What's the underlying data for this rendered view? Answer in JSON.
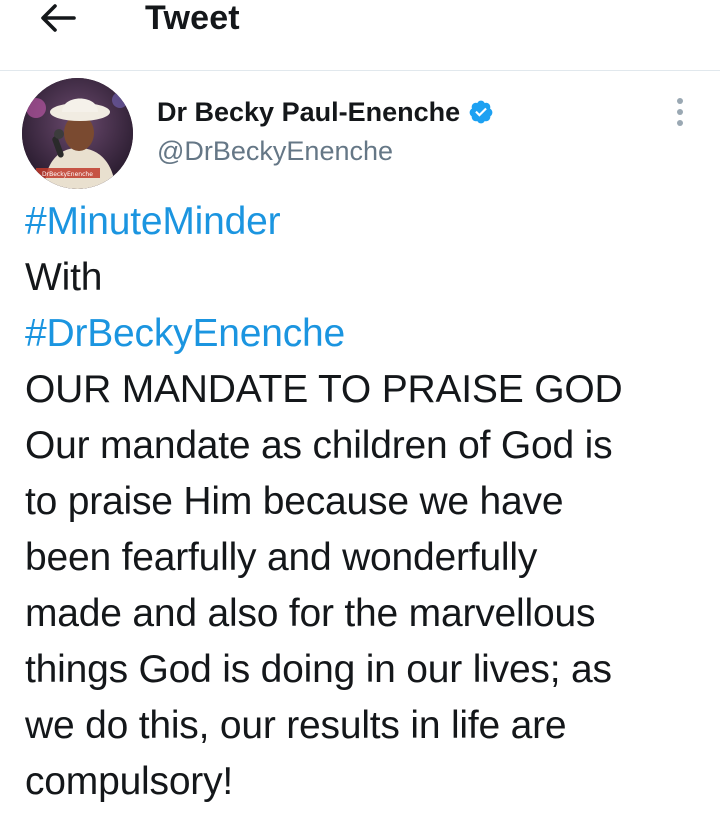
{
  "header": {
    "title": "Tweet",
    "back_icon": "arrow-left-icon"
  },
  "author": {
    "display_name": "Dr Becky Paul-Enenche",
    "handle": "@DrBeckyEnenche",
    "verified": true,
    "verified_icon": "verified-badge-icon",
    "avatar_watermark": "DrBeckyEnenche"
  },
  "more_icon": "more-vertical-icon",
  "tweet": {
    "hashtag_1": "#MinuteMinder",
    "line_with": "With",
    "hashtag_2": "#DrBeckyEnenche",
    "lines": [
      "OUR MANDATE TO PRAISE GOD",
      "Our mandate as children of God is",
      "to praise Him because we have",
      "been fearfully and wonderfully",
      "made and also for the marvellous",
      "things God is doing in our lives; as",
      "we do this, our results in life are",
      "compulsory!"
    ]
  },
  "colors": {
    "link": "#1b95e0",
    "text": "#14171a",
    "secondary": "#657786",
    "verified": "#1da1f2",
    "divider": "#e1e8ed"
  }
}
